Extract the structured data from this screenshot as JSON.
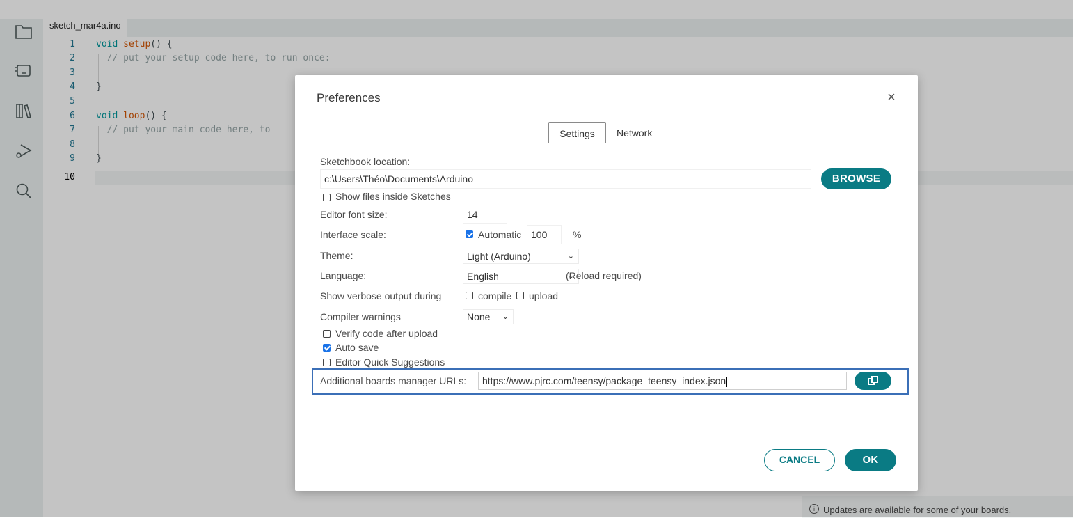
{
  "editor": {
    "tab_label": "sketch_mar4a.ino",
    "line_numbers": [
      "1",
      "2",
      "3",
      "4",
      "5",
      "6",
      "7",
      "8",
      "9",
      "10"
    ],
    "lines": {
      "l1_kw": "void",
      "l1_fn": "setup",
      "l1_rest": "() {",
      "l2_comment": "  // put your setup code here, to run once:",
      "l4": "}",
      "l6_kw": "void",
      "l6_fn": "loop",
      "l6_rest": "() {",
      "l7_comment": "  // put your main code here, to",
      "l9": "}"
    }
  },
  "sidebar": {
    "icons": [
      "folder-icon",
      "board-icon",
      "library-icon",
      "debug-icon",
      "search-icon"
    ]
  },
  "notification": {
    "icon": "i",
    "text": "Updates are available for some of your boards."
  },
  "dialog": {
    "title": "Preferences",
    "close": "×",
    "tabs": [
      "Settings",
      "Network"
    ],
    "sketchbook_label": "Sketchbook location:",
    "sketchbook_value": "c:\\Users\\Théo\\Documents\\Arduino",
    "browse_label": "BROWSE",
    "show_files_label": "Show files inside Sketches",
    "font_size_label": "Editor font size:",
    "font_size_value": "14",
    "scale_label": "Interface scale:",
    "scale_auto_label": "Automatic",
    "scale_value": "100",
    "scale_unit": "%",
    "theme_label": "Theme:",
    "theme_value": "Light (Arduino)",
    "language_label": "Language:",
    "language_value": "English",
    "language_note": "(Reload required)",
    "verbose_label": "Show verbose output during",
    "verbose_compile": "compile",
    "verbose_upload": "upload",
    "warnings_label": "Compiler warnings",
    "warnings_value": "None",
    "verify_label": "Verify code after upload",
    "autosave_label": "Auto save",
    "quick_suggestions_label": "Editor Quick Suggestions",
    "urls_label": "Additional boards manager URLs:",
    "urls_value": "https://www.pjrc.com/teensy/package_teensy_index.json",
    "cancel_label": "CANCEL",
    "ok_label": "OK",
    "checkboxes": {
      "show_files": false,
      "automatic": true,
      "compile": false,
      "upload": false,
      "verify": false,
      "autosave": true,
      "quick_suggestions": false
    }
  },
  "colors": {
    "accent": "#0a7b84",
    "focus_border": "#3b6fb7",
    "checkbox_checked": "#1a73e8"
  }
}
